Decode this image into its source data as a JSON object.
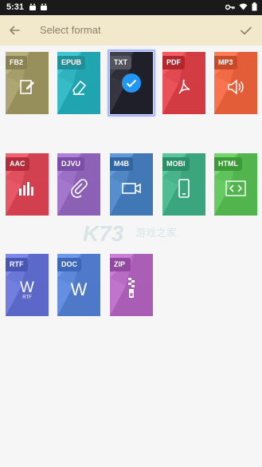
{
  "status": {
    "time": "5:31"
  },
  "toolbar": {
    "title": "Select format"
  },
  "formats": [
    {
      "label": "FB2",
      "color": "#a59d6a",
      "badge": "#8a8252",
      "icon": "edit-icon"
    },
    {
      "label": "EPUB",
      "color": "#2fb3bf",
      "badge": "#1f8f99",
      "icon": "eraser-icon"
    },
    {
      "label": "TXT",
      "color": "#2e2e38",
      "badge": "#55555f",
      "icon": "check-icon"
    },
    {
      "label": "PDF",
      "color": "#e04a50",
      "badge": "#b3262c",
      "icon": "pdf-icon"
    },
    {
      "label": "MP3",
      "color": "#f06b46",
      "badge": "#c84a28",
      "icon": "speaker-icon"
    },
    {
      "label": "AAC",
      "color": "#e04f5e",
      "badge": "#b22c3b",
      "icon": "equalizer-icon"
    },
    {
      "label": "DJVU",
      "color": "#9a6fc4",
      "badge": "#7a4ea6",
      "icon": "paperclip-icon"
    },
    {
      "label": "M4B",
      "color": "#4f86c3",
      "badge": "#2f66a3",
      "icon": "video-icon"
    },
    {
      "label": "MOBI",
      "color": "#49b38c",
      "badge": "#2c8e69",
      "icon": "phone-icon"
    },
    {
      "label": "HTML",
      "color": "#5fc25a",
      "badge": "#3c9b37",
      "icon": "code-icon"
    },
    {
      "label": "RTF",
      "color": "#6a77d6",
      "badge": "#4a56b4",
      "icon": "rtf-icon",
      "sub": "RTF"
    },
    {
      "label": "DOC",
      "color": "#5d87d8",
      "badge": "#3c66b7",
      "icon": "word-icon"
    },
    {
      "label": "ZIP",
      "color": "#b86cc4",
      "badge": "#914aa0",
      "icon": "zip-icon"
    }
  ],
  "selected": "TXT",
  "watermark": {
    "text": "K73",
    "sub": "游戏之家"
  }
}
